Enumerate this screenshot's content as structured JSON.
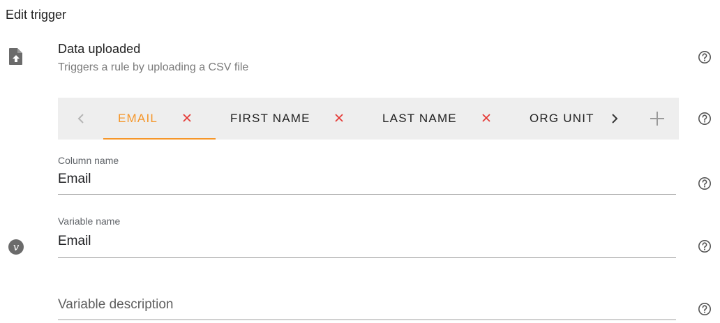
{
  "header": {
    "title": "Edit trigger"
  },
  "trigger": {
    "icon": "file-upload-icon",
    "title": "Data uploaded",
    "subtitle": "Triggers a rule by uploading a CSV file"
  },
  "columns": {
    "tabs": [
      {
        "label": "EMAIL",
        "active": true
      },
      {
        "label": "FIRST NAME",
        "active": false
      },
      {
        "label": "LAST NAME",
        "active": false
      },
      {
        "label": "ORG UNIT",
        "active": false
      }
    ],
    "accent_color": "#f5962a",
    "close_color": "#e53935"
  },
  "form": {
    "column_name": {
      "label": "Column name",
      "value": "Email"
    },
    "variable_name": {
      "label": "Variable name",
      "value": "Email"
    },
    "variable_description": {
      "placeholder": "Variable description",
      "value": ""
    },
    "variable_icon": "v"
  }
}
